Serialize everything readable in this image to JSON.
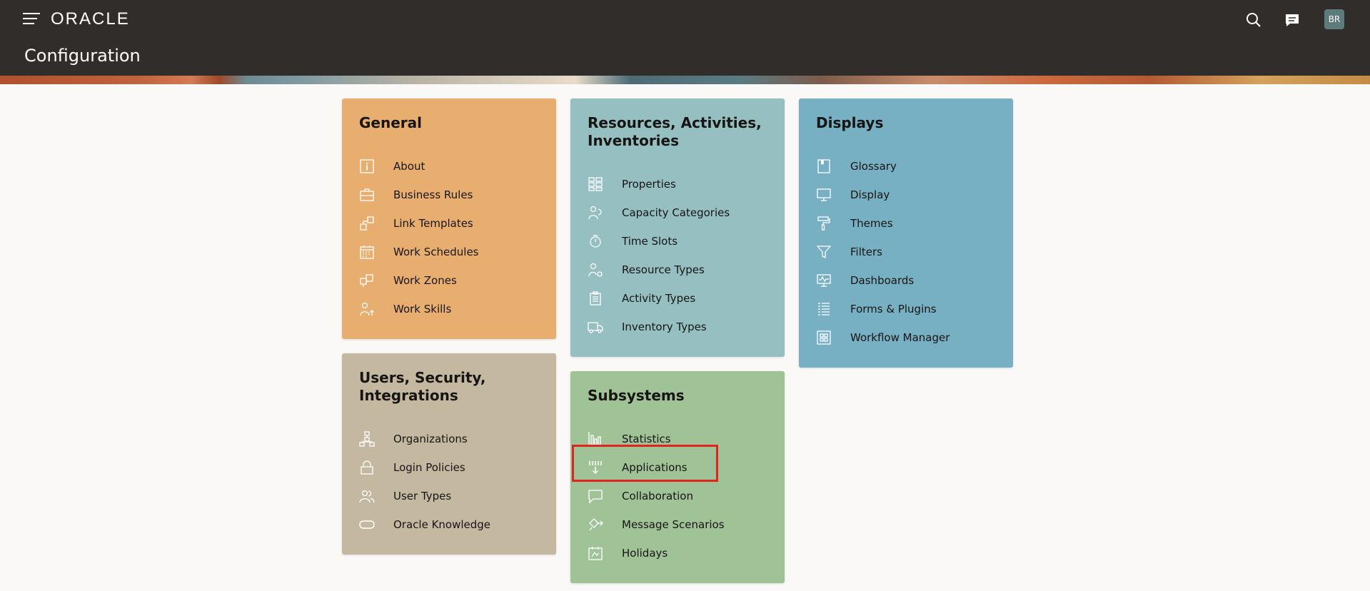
{
  "header": {
    "logo": "ORACLE",
    "title": "Configuration",
    "avatar_initials": "BR"
  },
  "cards": {
    "general": {
      "title": "General",
      "color": "#e8ae6f",
      "items": [
        {
          "label": "About",
          "icon": "info-icon"
        },
        {
          "label": "Business Rules",
          "icon": "briefcase-icon"
        },
        {
          "label": "Link Templates",
          "icon": "link-template-icon"
        },
        {
          "label": "Work Schedules",
          "icon": "calendar-icon"
        },
        {
          "label": "Work Zones",
          "icon": "zones-icon"
        },
        {
          "label": "Work Skills",
          "icon": "person-skill-icon"
        }
      ]
    },
    "resources": {
      "title": "Resources, Activities, Inventories",
      "color": "#95bfc0",
      "items": [
        {
          "label": "Properties",
          "icon": "properties-grid-icon"
        },
        {
          "label": "Capacity Categories",
          "icon": "capacity-icon"
        },
        {
          "label": "Time Slots",
          "icon": "timer-icon"
        },
        {
          "label": "Resource Types",
          "icon": "person-gear-icon"
        },
        {
          "label": "Activity Types",
          "icon": "clipboard-icon"
        },
        {
          "label": "Inventory Types",
          "icon": "truck-icon"
        }
      ]
    },
    "displays": {
      "title": "Displays",
      "color": "#76b0c2",
      "items": [
        {
          "label": "Glossary",
          "icon": "book-icon"
        },
        {
          "label": "Display",
          "icon": "monitor-icon"
        },
        {
          "label": "Themes",
          "icon": "paint-roller-icon"
        },
        {
          "label": "Filters",
          "icon": "filter-icon"
        },
        {
          "label": "Dashboards",
          "icon": "dashboard-icon"
        },
        {
          "label": "Forms & Plugins",
          "icon": "form-list-icon"
        },
        {
          "label": "Workflow Manager",
          "icon": "workflow-grid-icon"
        }
      ]
    },
    "users": {
      "title": "Users, Security, Integrations",
      "color": "#c5b8a0",
      "items": [
        {
          "label": "Organizations",
          "icon": "org-chart-icon"
        },
        {
          "label": "Login Policies",
          "icon": "lock-icon"
        },
        {
          "label": "User Types",
          "icon": "users-icon"
        },
        {
          "label": "Oracle Knowledge",
          "icon": "oracle-pill-icon"
        }
      ]
    },
    "subsystems": {
      "title": "Subsystems",
      "color": "#a0c297",
      "items": [
        {
          "label": "Statistics",
          "icon": "bar-chart-icon"
        },
        {
          "label": "Applications",
          "icon": "download-apps-icon"
        },
        {
          "label": "Collaboration",
          "icon": "chat-bubble-icon"
        },
        {
          "label": "Message Scenarios",
          "icon": "message-scenario-icon"
        },
        {
          "label": "Holidays",
          "icon": "holiday-calendar-icon"
        }
      ]
    }
  },
  "annotation": {
    "highlight_color": "#e0231c"
  }
}
